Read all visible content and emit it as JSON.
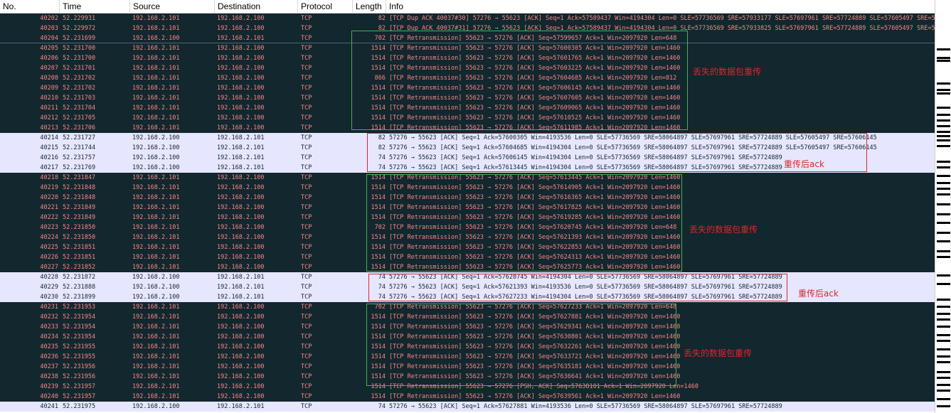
{
  "columns": {
    "no": "No.",
    "time": "Time",
    "source": "Source",
    "destination": "Destination",
    "protocol": "Protocol",
    "length": "Length",
    "info": "Info"
  },
  "packets": [
    {
      "no": "40202",
      "time": "52.229931",
      "src": "192.168.2.101",
      "dst": "192.168.2.100",
      "proto": "TCP",
      "len": "82",
      "info": "[TCP Dup ACK 40037#30] 57276 → 55623 [ACK] Seq=1 Ack=57589437 Win=4194304 Len=0 SLE=57736569 SRE=57933177 SLE=57697961 SRE=57724889 SLE=57605497 SRE=57…",
      "kind": "dupack"
    },
    {
      "no": "40203",
      "time": "52.229972",
      "src": "192.168.2.101",
      "dst": "192.168.2.100",
      "proto": "TCP",
      "len": "82",
      "info": "[TCP Dup ACK 40037#31] 57276 → 55623 [ACK] Seq=1 Ack=57589437 Win=4194304 Len=0 SLE=57736569 SRE=57933825 SLE=57697961 SRE=57724889 SLE=57605497 SRE=57…",
      "kind": "dupack"
    },
    {
      "no": "40204",
      "time": "52.231699",
      "src": "192.168.2.100",
      "dst": "192.168.2.101",
      "proto": "TCP",
      "len": "702",
      "info": "[TCP Retransmission] 55623 → 57276 [ACK] Seq=57599657 Ack=1 Win=2097920 Len=648",
      "kind": "sel"
    },
    {
      "no": "40205",
      "time": "52.231700",
      "src": "192.168.2.101",
      "dst": "192.168.2.100",
      "proto": "TCP",
      "len": "1514",
      "info": "[TCP Retransmission] 55623 → 57276 [ACK] Seq=57600305 Ack=1 Win=2097920 Len=1460",
      "kind": "rt"
    },
    {
      "no": "40206",
      "time": "52.231700",
      "src": "192.168.2.101",
      "dst": "192.168.2.100",
      "proto": "TCP",
      "len": "1514",
      "info": "[TCP Retransmission] 55623 → 57276 [ACK] Seq=57601765 Ack=1 Win=2097920 Len=1460",
      "kind": "rt"
    },
    {
      "no": "40207",
      "time": "52.231701",
      "src": "192.168.2.101",
      "dst": "192.168.2.100",
      "proto": "TCP",
      "len": "1514",
      "info": "[TCP Retransmission] 55623 → 57276 [ACK] Seq=57603225 Ack=1 Win=2097920 Len=1460",
      "kind": "rt"
    },
    {
      "no": "40208",
      "time": "52.231702",
      "src": "192.168.2.101",
      "dst": "192.168.2.100",
      "proto": "TCP",
      "len": "866",
      "info": "[TCP Retransmission] 55623 → 57276 [ACK] Seq=57604685 Ack=1 Win=2097920 Len=812",
      "kind": "rt"
    },
    {
      "no": "40209",
      "time": "52.231702",
      "src": "192.168.2.101",
      "dst": "192.168.2.100",
      "proto": "TCP",
      "len": "1514",
      "info": "[TCP Retransmission] 55623 → 57276 [ACK] Seq=57606145 Ack=1 Win=2097920 Len=1460",
      "kind": "rt"
    },
    {
      "no": "40210",
      "time": "52.231703",
      "src": "192.168.2.101",
      "dst": "192.168.2.100",
      "proto": "TCP",
      "len": "1514",
      "info": "[TCP Retransmission] 55623 → 57276 [ACK] Seq=57607605 Ack=1 Win=2097920 Len=1460",
      "kind": "rt"
    },
    {
      "no": "40211",
      "time": "52.231704",
      "src": "192.168.2.101",
      "dst": "192.168.2.100",
      "proto": "TCP",
      "len": "1514",
      "info": "[TCP Retransmission] 55623 → 57276 [ACK] Seq=57609065 Ack=1 Win=2097920 Len=1460",
      "kind": "rt"
    },
    {
      "no": "40212",
      "time": "52.231705",
      "src": "192.168.2.101",
      "dst": "192.168.2.100",
      "proto": "TCP",
      "len": "1514",
      "info": "[TCP Retransmission] 55623 → 57276 [ACK] Seq=57610525 Ack=1 Win=2097920 Len=1460",
      "kind": "rt"
    },
    {
      "no": "40213",
      "time": "52.231706",
      "src": "192.168.2.101",
      "dst": "192.168.2.100",
      "proto": "TCP",
      "len": "1514",
      "info": "[TCP Retransmission] 55623 → 57276 [ACK] Seq=57611985 Ack=1 Win=2097920 Len=1460",
      "kind": "rt"
    },
    {
      "no": "40214",
      "time": "52.231727",
      "src": "192.168.2.100",
      "dst": "192.168.2.101",
      "proto": "TCP",
      "len": "82",
      "info": "57276 → 55623 [ACK] Seq=1 Ack=57600305 Win=4193536 Len=0 SLE=57736569 SRE=58064897 SLE=57697961 SRE=57724889 SLE=57605497 SRE=57606145",
      "kind": "ack"
    },
    {
      "no": "40215",
      "time": "52.231744",
      "src": "192.168.2.100",
      "dst": "192.168.2.101",
      "proto": "TCP",
      "len": "82",
      "info": "57276 → 55623 [ACK] Seq=1 Ack=57604685 Win=4194304 Len=0 SLE=57736569 SRE=58064897 SLE=57697961 SRE=57724889 SLE=57605497 SRE=57606145",
      "kind": "ack"
    },
    {
      "no": "40216",
      "time": "52.231757",
      "src": "192.168.2.100",
      "dst": "192.168.2.101",
      "proto": "TCP",
      "len": "74",
      "info": "57276 → 55623 [ACK] Seq=1 Ack=57606145 Win=4194304 Len=0 SLE=57736569 SRE=58064897 SLE=57697961 SRE=57724889",
      "kind": "ack"
    },
    {
      "no": "40217",
      "time": "52.231769",
      "src": "192.168.2.100",
      "dst": "192.168.2.101",
      "proto": "TCP",
      "len": "74",
      "info": "57276 → 55623 [ACK] Seq=1 Ack=57613445 Win=4194304 Len=0 SLE=57736569 SRE=58064897 SLE=57697961 SRE=57724889",
      "kind": "ack"
    },
    {
      "no": "40218",
      "time": "52.231847",
      "src": "192.168.2.101",
      "dst": "192.168.2.100",
      "proto": "TCP",
      "len": "1514",
      "info": "[TCP Retransmission] 55623 → 57276 [ACK] Seq=57613445 Ack=1 Win=2097920 Len=1460",
      "kind": "rt"
    },
    {
      "no": "40219",
      "time": "52.231848",
      "src": "192.168.2.101",
      "dst": "192.168.2.100",
      "proto": "TCP",
      "len": "1514",
      "info": "[TCP Retransmission] 55623 → 57276 [ACK] Seq=57614905 Ack=1 Win=2097920 Len=1460",
      "kind": "rt"
    },
    {
      "no": "40220",
      "time": "52.231848",
      "src": "192.168.2.101",
      "dst": "192.168.2.100",
      "proto": "TCP",
      "len": "1514",
      "info": "[TCP Retransmission] 55623 → 57276 [ACK] Seq=57616365 Ack=1 Win=2097920 Len=1460",
      "kind": "rt"
    },
    {
      "no": "40221",
      "time": "52.231849",
      "src": "192.168.2.101",
      "dst": "192.168.2.100",
      "proto": "TCP",
      "len": "1514",
      "info": "[TCP Retransmission] 55623 → 57276 [ACK] Seq=57617825 Ack=1 Win=2097920 Len=1460",
      "kind": "rt"
    },
    {
      "no": "40222",
      "time": "52.231849",
      "src": "192.168.2.101",
      "dst": "192.168.2.100",
      "proto": "TCP",
      "len": "1514",
      "info": "[TCP Retransmission] 55623 → 57276 [ACK] Seq=57619285 Ack=1 Win=2097920 Len=1460",
      "kind": "rt"
    },
    {
      "no": "40223",
      "time": "52.231850",
      "src": "192.168.2.101",
      "dst": "192.168.2.100",
      "proto": "TCP",
      "len": "702",
      "info": "[TCP Retransmission] 55623 → 57276 [ACK] Seq=57620745 Ack=1 Win=2097920 Len=648",
      "kind": "rt"
    },
    {
      "no": "40224",
      "time": "52.231850",
      "src": "192.168.2.101",
      "dst": "192.168.2.100",
      "proto": "TCP",
      "len": "1514",
      "info": "[TCP Retransmission] 55623 → 57276 [ACK] Seq=57621393 Ack=1 Win=2097920 Len=1460",
      "kind": "rt"
    },
    {
      "no": "40225",
      "time": "52.231851",
      "src": "192.168.2.101",
      "dst": "192.168.2.100",
      "proto": "TCP",
      "len": "1514",
      "info": "[TCP Retransmission] 55623 → 57276 [ACK] Seq=57622853 Ack=1 Win=2097920 Len=1460",
      "kind": "rt"
    },
    {
      "no": "40226",
      "time": "52.231851",
      "src": "192.168.2.101",
      "dst": "192.168.2.100",
      "proto": "TCP",
      "len": "1514",
      "info": "[TCP Retransmission] 55623 → 57276 [ACK] Seq=57624313 Ack=1 Win=2097920 Len=1460",
      "kind": "rt"
    },
    {
      "no": "40227",
      "time": "52.231852",
      "src": "192.168.2.101",
      "dst": "192.168.2.100",
      "proto": "TCP",
      "len": "1514",
      "info": "[TCP Retransmission] 55623 → 57276 [ACK] Seq=57625773 Ack=1 Win=2097920 Len=1460",
      "kind": "rt"
    },
    {
      "no": "40228",
      "time": "52.231872",
      "src": "192.168.2.100",
      "dst": "192.168.2.101",
      "proto": "TCP",
      "len": "74",
      "info": "57276 → 55623 [ACK] Seq=1 Ack=57620745 Win=4194304 Len=0 SLE=57736569 SRE=58064897 SLE=57697961 SRE=57724889",
      "kind": "ack"
    },
    {
      "no": "40229",
      "time": "52.231888",
      "src": "192.168.2.100",
      "dst": "192.168.2.101",
      "proto": "TCP",
      "len": "74",
      "info": "57276 → 55623 [ACK] Seq=1 Ack=57621393 Win=4193536 Len=0 SLE=57736569 SRE=58064897 SLE=57697961 SRE=57724889",
      "kind": "ack"
    },
    {
      "no": "40230",
      "time": "52.231899",
      "src": "192.168.2.100",
      "dst": "192.168.2.101",
      "proto": "TCP",
      "len": "74",
      "info": "57276 → 55623 [ACK] Seq=1 Ack=57627233 Win=4194304 Len=0 SLE=57736569 SRE=58064897 SLE=57697961 SRE=57724889",
      "kind": "ack"
    },
    {
      "no": "40231",
      "time": "52.231953",
      "src": "192.168.2.101",
      "dst": "192.168.2.100",
      "proto": "TCP",
      "len": "702",
      "info": "[TCP Retransmission] 55623 → 57276 [ACK] Seq=57627233 Ack=1 Win=2097920 Len=648",
      "kind": "rt"
    },
    {
      "no": "40232",
      "time": "52.231954",
      "src": "192.168.2.101",
      "dst": "192.168.2.100",
      "proto": "TCP",
      "len": "1514",
      "info": "[TCP Retransmission] 55623 → 57276 [ACK] Seq=57627881 Ack=1 Win=2097920 Len=1460",
      "kind": "rt"
    },
    {
      "no": "40233",
      "time": "52.231954",
      "src": "192.168.2.101",
      "dst": "192.168.2.100",
      "proto": "TCP",
      "len": "1514",
      "info": "[TCP Retransmission] 55623 → 57276 [ACK] Seq=57629341 Ack=1 Win=2097920 Len=1460",
      "kind": "rt"
    },
    {
      "no": "40234",
      "time": "52.231954",
      "src": "192.168.2.101",
      "dst": "192.168.2.100",
      "proto": "TCP",
      "len": "1514",
      "info": "[TCP Retransmission] 55623 → 57276 [ACK] Seq=57630801 Ack=1 Win=2097920 Len=1460",
      "kind": "rt"
    },
    {
      "no": "40235",
      "time": "52.231955",
      "src": "192.168.2.101",
      "dst": "192.168.2.100",
      "proto": "TCP",
      "len": "1514",
      "info": "[TCP Retransmission] 55623 → 57276 [ACK] Seq=57632261 Ack=1 Win=2097920 Len=1460",
      "kind": "rt"
    },
    {
      "no": "40236",
      "time": "52.231955",
      "src": "192.168.2.101",
      "dst": "192.168.2.100",
      "proto": "TCP",
      "len": "1514",
      "info": "[TCP Retransmission] 55623 → 57276 [ACK] Seq=57633721 Ack=1 Win=2097920 Len=1460",
      "kind": "rt"
    },
    {
      "no": "40237",
      "time": "52.231956",
      "src": "192.168.2.101",
      "dst": "192.168.2.100",
      "proto": "TCP",
      "len": "1514",
      "info": "[TCP Retransmission] 55623 → 57276 [ACK] Seq=57635181 Ack=1 Win=2097920 Len=1460",
      "kind": "rt"
    },
    {
      "no": "40238",
      "time": "52.231956",
      "src": "192.168.2.101",
      "dst": "192.168.2.100",
      "proto": "TCP",
      "len": "1514",
      "info": "[TCP Retransmission] 55623 → 57276 [ACK] Seq=57636641 Ack=1 Win=2097920 Len=1460",
      "kind": "rt"
    },
    {
      "no": "40239",
      "time": "52.231957",
      "src": "192.168.2.101",
      "dst": "192.168.2.100",
      "proto": "TCP",
      "len": "1514",
      "info": "[TCP Retransmission] 55623 → 57276 [PSH, ACK] Seq=57638101 Ack=1 Win=2097920 Len=1460",
      "kind": "rt"
    },
    {
      "no": "40240",
      "time": "52.231957",
      "src": "192.168.2.101",
      "dst": "192.168.2.100",
      "proto": "TCP",
      "len": "1514",
      "info": "[TCP Retransmission] 55623 → 57276 [ACK] Seq=57639561 Ack=1 Win=2097920 Len=1460",
      "kind": "rt"
    },
    {
      "no": "40241",
      "time": "52.231975",
      "src": "192.168.2.100",
      "dst": "192.168.2.101",
      "proto": "TCP",
      "len": "74",
      "info": "57276 → 55623 [ACK] Seq=1 Ack=57627881 Win=4193536 Len=0 SLE=57736569 SRE=58064897 SLE=57697961 SRE=57724889",
      "kind": "ack"
    }
  ],
  "annotations": {
    "lost_retransmit_1": "丢失的数据包重传",
    "ack_after_retransmit_1": "重传后ack",
    "lost_retransmit_2": "丢失的数据包重传",
    "ack_after_retransmit_2": "重传后ack",
    "lost_retransmit_3": "丢失的数据包重传"
  },
  "colors": {
    "retransmission_row_bg": "#12272e",
    "retransmission_row_fg": "#f78787",
    "ack_row_bg": "#e7e6ff",
    "ack_row_fg": "#12272e",
    "green_box": "#4caf50",
    "red_box": "#e0252b"
  }
}
